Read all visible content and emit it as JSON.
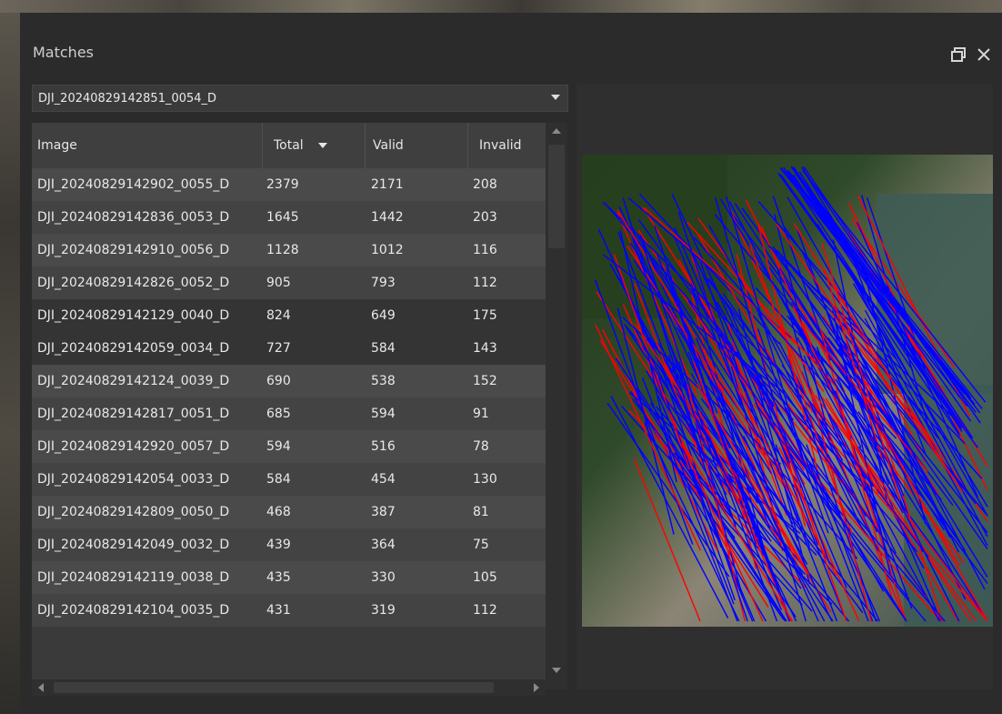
{
  "panel": {
    "title": "Matches",
    "controls": {
      "restore_icon": "restore-window-icon",
      "close_icon": "close-icon"
    }
  },
  "combo": {
    "selected": "DJI_20240829142851_0054_D",
    "icon": "chevron-down-icon"
  },
  "table": {
    "columns": [
      "Image",
      "Total",
      "Valid",
      "Invalid"
    ],
    "sort_icon": "sort-descending-icon",
    "rows": [
      {
        "image": "DJI_20240829142902_0055_D",
        "total": "2379",
        "valid": "2171",
        "invalid": "208"
      },
      {
        "image": "DJI_20240829142836_0053_D",
        "total": "1645",
        "valid": "1442",
        "invalid": "203"
      },
      {
        "image": "DJI_20240829142910_0056_D",
        "total": "1128",
        "valid": "1012",
        "invalid": "116"
      },
      {
        "image": "DJI_20240829142826_0052_D",
        "total": "905",
        "valid": "793",
        "invalid": "112"
      },
      {
        "image": "DJI_20240829142129_0040_D",
        "total": "824",
        "valid": "649",
        "invalid": "175"
      },
      {
        "image": "DJI_20240829142059_0034_D",
        "total": "727",
        "valid": "584",
        "invalid": "143"
      },
      {
        "image": "DJI_20240829142124_0039_D",
        "total": "690",
        "valid": "538",
        "invalid": "152"
      },
      {
        "image": "DJI_20240829142817_0051_D",
        "total": "685",
        "valid": "594",
        "invalid": "91"
      },
      {
        "image": "DJI_20240829142920_0057_D",
        "total": "594",
        "valid": "516",
        "invalid": "78"
      },
      {
        "image": "DJI_20240829142054_0033_D",
        "total": "584",
        "valid": "454",
        "invalid": "130"
      },
      {
        "image": "DJI_20240829142809_0050_D",
        "total": "468",
        "valid": "387",
        "invalid": "81"
      },
      {
        "image": "DJI_20240829142049_0032_D",
        "total": "439",
        "valid": "364",
        "invalid": "75"
      },
      {
        "image": "DJI_20240829142119_0038_D",
        "total": "435",
        "valid": "330",
        "invalid": "105"
      },
      {
        "image": "DJI_20240829142104_0035_D",
        "total": "431",
        "valid": "319",
        "invalid": "112"
      }
    ]
  },
  "viewer": {
    "match_colors": {
      "valid": "#0000ff",
      "invalid": "#ff0000"
    }
  }
}
